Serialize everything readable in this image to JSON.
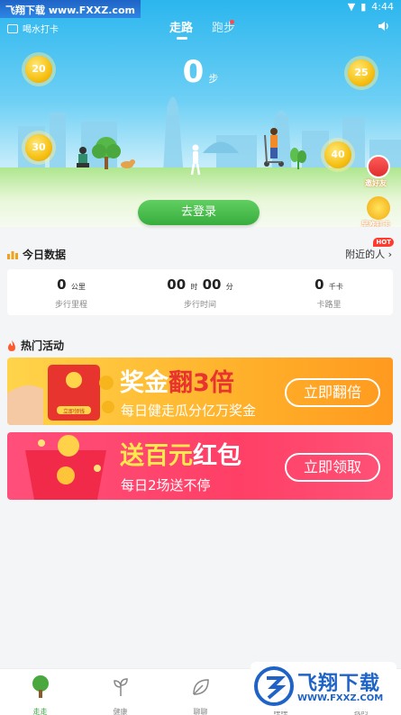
{
  "status_bar": {
    "watermark": "飞翔下载 www.FXXZ.com",
    "time": "4:44"
  },
  "header": {
    "drink_checkin": "喝水打卡",
    "tabs": [
      {
        "label": "走路",
        "active": true
      },
      {
        "label": "跑步",
        "active": false
      }
    ]
  },
  "steps": {
    "value": "0",
    "unit": "步"
  },
  "coins": [
    "20",
    "25",
    "30",
    "40"
  ],
  "side_buttons": {
    "invite": "邀好友",
    "early_checkin": "早晚打卡"
  },
  "login_button": "去登录",
  "today": {
    "title": "今日数据",
    "nearby": "附近的人",
    "hot_badge": "HOT",
    "stats": [
      {
        "value": "0",
        "unit": "公里",
        "label": "步行里程"
      },
      {
        "value": "00",
        "unit": "时",
        "value2": "00",
        "unit2": "分",
        "label": "步行时间"
      },
      {
        "value": "0",
        "unit": "千卡",
        "label": "卡路里"
      }
    ]
  },
  "activities": {
    "title": "热门活动",
    "banners": [
      {
        "title_a": "奖金",
        "title_b": "翻3倍",
        "subtitle": "每日健走瓜分亿万奖金",
        "button": "立即翻倍",
        "envelope_text": "立即领钱"
      },
      {
        "title_a": "送百元",
        "title_b": "红包",
        "subtitle": "每日2场送不停",
        "button": "立即领取"
      }
    ]
  },
  "bottom_nav": [
    {
      "label": "走走",
      "icon": "tree-icon",
      "active": true
    },
    {
      "label": "健康",
      "icon": "sprout-icon",
      "active": false
    },
    {
      "label": "聊聊",
      "icon": "leaf-icon",
      "active": false
    },
    {
      "label": "睡睡",
      "icon": "moon-icon",
      "active": false
    },
    {
      "label": "我的",
      "icon": "user-icon",
      "active": false
    }
  ],
  "watermark_bottom": {
    "text": "飞翔下载",
    "url": "WWW.FXXZ.COM"
  },
  "colors": {
    "accent_green": "#37ad3d",
    "sky": "#2bb6ee",
    "banner_orange": "#ffb12b",
    "banner_pink": "#ff3f66"
  }
}
